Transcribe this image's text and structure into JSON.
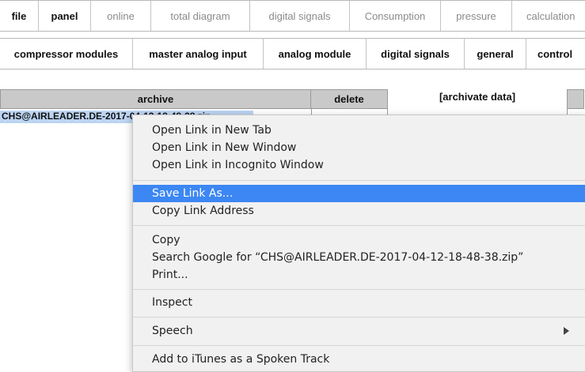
{
  "nav_primary": [
    {
      "label": "file",
      "style": "primary"
    },
    {
      "label": "panel",
      "style": "primary"
    },
    {
      "label": "online",
      "style": "dim"
    },
    {
      "label": "total diagram",
      "style": "dim"
    },
    {
      "label": "digital signals",
      "style": "dim"
    },
    {
      "label": "Consumption",
      "style": "dim"
    },
    {
      "label": "pressure",
      "style": "dim"
    },
    {
      "label": "calculation",
      "style": "dim"
    }
  ],
  "nav_secondary": [
    {
      "label": "compressor modules"
    },
    {
      "label": "master analog input"
    },
    {
      "label": "analog module"
    },
    {
      "label": "digital signals"
    },
    {
      "label": "general"
    },
    {
      "label": "control"
    }
  ],
  "archive_table": {
    "headers": {
      "archive": "archive",
      "delete": "delete",
      "archivate": "[archivate data]"
    },
    "rows": [
      {
        "file": "CHS@AIRLEADER.DE-2017-04-12-18-48-38.zip"
      }
    ]
  },
  "context_menu": {
    "items": [
      {
        "label": "Open Link in New Tab"
      },
      {
        "label": "Open Link in New Window"
      },
      {
        "label": "Open Link in Incognito Window"
      },
      {
        "label": "Save Link As...",
        "highlighted": true
      },
      {
        "label": "Copy Link Address"
      },
      {
        "label": "Copy"
      },
      {
        "label": "Search Google for “CHS@AIRLEADER.DE-2017-04-12-18-48-38.zip”"
      },
      {
        "label": "Print..."
      },
      {
        "label": "Inspect"
      },
      {
        "label": "Speech",
        "has_submenu": true
      },
      {
        "label": "Add to iTunes as a Spoken Track"
      }
    ]
  },
  "colors": {
    "menu_highlight": "#3c87f3",
    "table_header_bg": "#c9c9c9",
    "selection_bg": "#bcd4f2",
    "dim_tab_text": "#8a8a8a"
  }
}
